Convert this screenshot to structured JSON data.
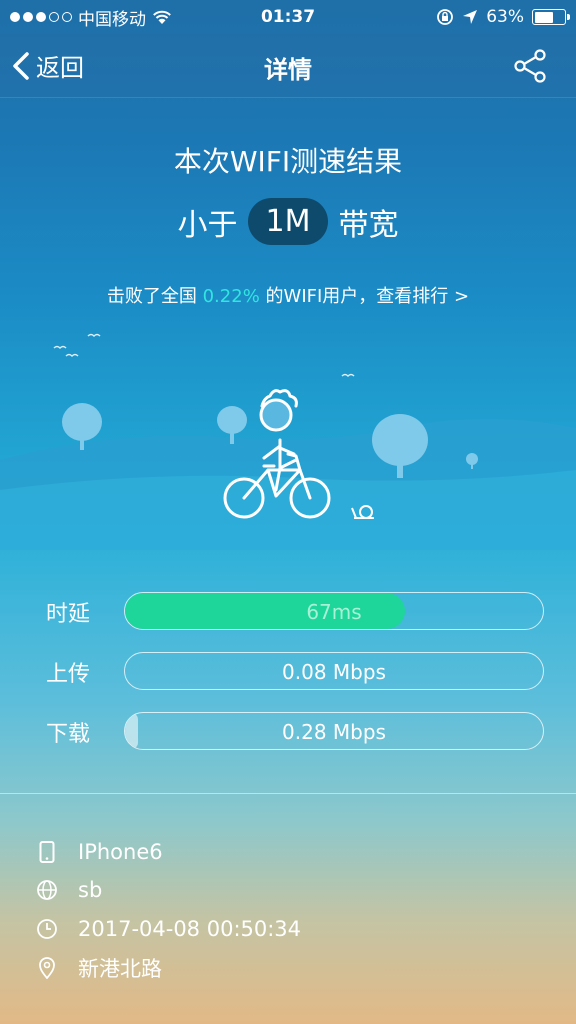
{
  "status_bar": {
    "carrier": "中国移动",
    "time": "01:37",
    "battery_percent": "63%",
    "battery_level": 0.63
  },
  "nav": {
    "back_label": "返回",
    "title": "详情"
  },
  "result": {
    "title": "本次WIFI测速结果",
    "band_prefix": "小于",
    "band_value": "1M",
    "band_suffix": "带宽",
    "rank_prefix": "击败了全国",
    "rank_percent": "0.22%",
    "rank_suffix": "的WIFI用户，查看排行 >"
  },
  "metrics": [
    {
      "label": "时延",
      "value": "67ms",
      "fill_fraction": 0.67
    },
    {
      "label": "上传",
      "value": "0.08 Mbps",
      "fill_fraction": 0.0
    },
    {
      "label": "下载",
      "value": "0.28 Mbps",
      "fill_fraction": 0.03
    }
  ],
  "info": {
    "device": "IPhone6",
    "network": "sb",
    "datetime": "2017-04-08 00:50:34",
    "location": "新港北路"
  },
  "colors": {
    "accent_cyan": "#2fe6e0",
    "latency_green": "#1fd69a",
    "band_pill": "#0e4a6c"
  }
}
